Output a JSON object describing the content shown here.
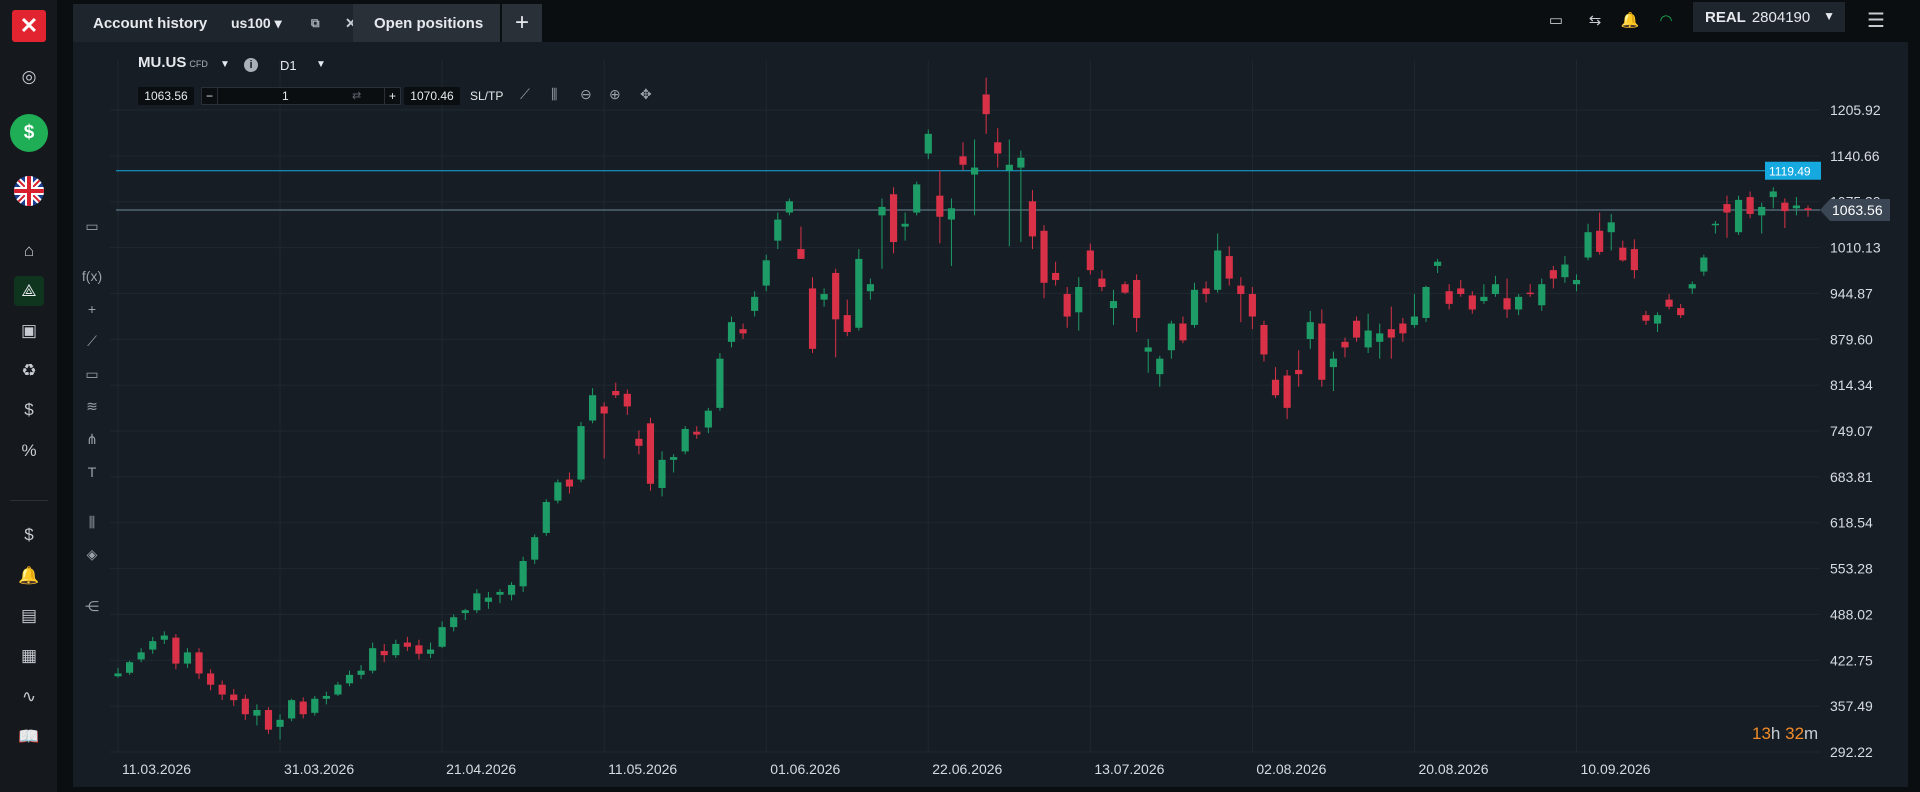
{
  "left_rail": {
    "logo_label": "✕",
    "deposit_label": "$",
    "items": [
      {
        "name": "home-icon",
        "glyph": "⌂"
      },
      {
        "name": "market-watch-icon",
        "glyph": "⟁"
      },
      {
        "name": "news-icon",
        "glyph": "▣"
      },
      {
        "name": "piggy-bank-icon",
        "glyph": "♻"
      },
      {
        "name": "coin-icon",
        "glyph": "$"
      },
      {
        "name": "percent-icon",
        "glyph": "%"
      },
      {
        "name": "transfer-icon",
        "glyph": "$"
      },
      {
        "name": "alerts-icon",
        "glyph": "🔔"
      },
      {
        "name": "reports-icon",
        "glyph": "▤"
      },
      {
        "name": "calendar-icon",
        "glyph": "▦"
      },
      {
        "name": "analytics-icon",
        "glyph": "∿"
      },
      {
        "name": "education-icon",
        "glyph": "📖"
      }
    ]
  },
  "topbar": {
    "tabs": {
      "account_history": "Account history",
      "workspace": "us100",
      "open_positions": "Open positions",
      "add": "+"
    },
    "account": {
      "mode": "REAL",
      "number": "2804190"
    }
  },
  "chart": {
    "symbol": "MU.US",
    "symbol_tag": "CFD",
    "timeframe": "D1",
    "sell_price": "1063.56",
    "buy_price": "1070.46",
    "volume": "1",
    "sltp_label": "SL/TP",
    "timer": {
      "hours": "13",
      "h": "h",
      "minutes": "32",
      "m": "m"
    },
    "colors": {
      "up": "#1e9c67",
      "down": "#d93147",
      "bg": "#161d24",
      "grid": "#1f2831",
      "alert_line": "#16a9e0",
      "price_line": "#6c8a9a"
    }
  },
  "chart_data": {
    "type": "candlestick",
    "symbol": "MU.US",
    "timeframe": "D1",
    "y_ticks": [
      292.22,
      357.49,
      422.75,
      488.02,
      553.28,
      618.54,
      683.81,
      749.07,
      814.34,
      879.6,
      944.87,
      1010.13,
      1075.39,
      1140.66,
      1205.92
    ],
    "y_tick_labels": [
      "292.22",
      "357.49",
      "422.75",
      "488.02",
      "553.28",
      "618.54",
      "683.81",
      "749.07",
      "814.34",
      "879.60",
      "944.87",
      "1010.13",
      "1075.39",
      "1140.66",
      "1205.92"
    ],
    "x_labels": [
      "11.03.2026",
      "31.03.2026",
      "21.04.2026",
      "11.05.2026",
      "01.06.2026",
      "22.06.2026",
      "13.07.2026",
      "02.08.2026",
      "20.08.2026",
      "10.09.2026"
    ],
    "x_label_bar_index": [
      0,
      14,
      28,
      42,
      56,
      70,
      84,
      98,
      112,
      126
    ],
    "ylim": [
      292.22,
      1205.92
    ],
    "current_price": 1063.56,
    "current_price_label": "1063.56",
    "alert_level": 1119.49,
    "alert_level_label": "1119.49",
    "ohlc": [
      [
        400,
        412,
        398,
        404
      ],
      [
        405,
        422,
        402,
        420
      ],
      [
        424,
        440,
        420,
        434
      ],
      [
        438,
        456,
        432,
        450
      ],
      [
        452,
        464,
        446,
        458
      ],
      [
        455,
        460,
        410,
        418
      ],
      [
        418,
        440,
        412,
        434
      ],
      [
        434,
        440,
        396,
        404
      ],
      [
        404,
        410,
        380,
        388
      ],
      [
        388,
        394,
        366,
        374
      ],
      [
        374,
        382,
        358,
        366
      ],
      [
        368,
        374,
        338,
        346
      ],
      [
        344,
        360,
        330,
        352
      ],
      [
        352,
        356,
        318,
        324
      ],
      [
        328,
        346,
        310,
        338
      ],
      [
        340,
        368,
        336,
        366
      ],
      [
        364,
        370,
        340,
        346
      ],
      [
        348,
        372,
        344,
        368
      ],
      [
        368,
        378,
        360,
        372
      ],
      [
        374,
        392,
        372,
        388
      ],
      [
        390,
        408,
        386,
        402
      ],
      [
        402,
        416,
        396,
        408
      ],
      [
        408,
        448,
        404,
        440
      ],
      [
        436,
        446,
        420,
        430
      ],
      [
        430,
        452,
        426,
        446
      ],
      [
        448,
        456,
        436,
        442
      ],
      [
        444,
        452,
        424,
        432
      ],
      [
        432,
        448,
        426,
        438
      ],
      [
        442,
        478,
        440,
        470
      ],
      [
        470,
        488,
        464,
        484
      ],
      [
        490,
        496,
        480,
        494
      ],
      [
        494,
        524,
        490,
        518
      ],
      [
        506,
        520,
        496,
        512
      ],
      [
        516,
        524,
        504,
        520
      ],
      [
        516,
        534,
        508,
        530
      ],
      [
        528,
        570,
        520,
        564
      ],
      [
        566,
        602,
        560,
        598
      ],
      [
        604,
        652,
        600,
        648
      ],
      [
        650,
        680,
        646,
        676
      ],
      [
        680,
        690,
        660,
        670
      ],
      [
        680,
        762,
        676,
        756
      ],
      [
        764,
        810,
        760,
        800
      ],
      [
        784,
        790,
        710,
        774
      ],
      [
        806,
        818,
        796,
        800
      ],
      [
        802,
        808,
        772,
        784
      ],
      [
        738,
        750,
        716,
        728
      ],
      [
        760,
        768,
        664,
        674
      ],
      [
        668,
        720,
        656,
        708
      ],
      [
        708,
        716,
        690,
        712
      ],
      [
        720,
        756,
        716,
        752
      ],
      [
        748,
        756,
        738,
        744
      ],
      [
        754,
        782,
        746,
        778
      ],
      [
        782,
        860,
        778,
        852
      ],
      [
        876,
        912,
        868,
        904
      ],
      [
        894,
        902,
        880,
        888
      ],
      [
        920,
        948,
        912,
        940
      ],
      [
        956,
        1000,
        948,
        992
      ],
      [
        1020,
        1060,
        1008,
        1050
      ],
      [
        1060,
        1080,
        1056,
        1076
      ],
      [
        1008,
        1040,
        996,
        994
      ],
      [
        952,
        968,
        860,
        866
      ],
      [
        936,
        952,
        926,
        944
      ],
      [
        974,
        980,
        854,
        908
      ],
      [
        914,
        936,
        884,
        890
      ],
      [
        896,
        1008,
        892,
        994
      ],
      [
        948,
        966,
        936,
        958
      ],
      [
        1056,
        1080,
        980,
        1068
      ],
      [
        1086,
        1096,
        1002,
        1018
      ],
      [
        1040,
        1060,
        1020,
        1044
      ],
      [
        1060,
        1104,
        1056,
        1100
      ],
      [
        1144,
        1178,
        1136,
        1172
      ],
      [
        1084,
        1120,
        1016,
        1054
      ],
      [
        1050,
        1080,
        984,
        1066
      ],
      [
        1140,
        1160,
        1120,
        1128
      ],
      [
        1114,
        1164,
        1056,
        1124
      ],
      [
        1228,
        1252,
        1172,
        1200
      ],
      [
        1160,
        1180,
        1124,
        1144
      ],
      [
        1120,
        1164,
        1012,
        1128
      ],
      [
        1124,
        1148,
        1018,
        1138
      ],
      [
        1076,
        1092,
        1008,
        1026
      ],
      [
        1034,
        1042,
        938,
        960
      ],
      [
        974,
        990,
        956,
        964
      ],
      [
        944,
        954,
        896,
        912
      ],
      [
        918,
        968,
        892,
        954
      ],
      [
        1006,
        1016,
        972,
        978
      ],
      [
        966,
        978,
        948,
        954
      ],
      [
        924,
        950,
        900,
        934
      ],
      [
        958,
        962,
        944,
        946
      ],
      [
        964,
        972,
        890,
        910
      ],
      [
        862,
        880,
        832,
        868
      ],
      [
        830,
        856,
        812,
        852
      ],
      [
        864,
        906,
        852,
        902
      ],
      [
        902,
        912,
        874,
        878
      ],
      [
        900,
        960,
        896,
        950
      ],
      [
        952,
        962,
        932,
        944
      ],
      [
        950,
        1030,
        946,
        1006
      ],
      [
        998,
        1012,
        956,
        966
      ],
      [
        956,
        968,
        904,
        944
      ],
      [
        944,
        954,
        894,
        912
      ],
      [
        900,
        906,
        848,
        858
      ],
      [
        822,
        840,
        796,
        800
      ],
      [
        828,
        836,
        766,
        782
      ],
      [
        836,
        864,
        812,
        830
      ],
      [
        880,
        920,
        866,
        904
      ],
      [
        902,
        922,
        812,
        822
      ],
      [
        840,
        862,
        806,
        852
      ],
      [
        876,
        882,
        854,
        868
      ],
      [
        906,
        912,
        876,
        882
      ],
      [
        868,
        916,
        860,
        892
      ],
      [
        876,
        902,
        852,
        888
      ],
      [
        894,
        926,
        852,
        882
      ],
      [
        902,
        910,
        876,
        888
      ],
      [
        900,
        944,
        896,
        912
      ],
      [
        910,
        956,
        904,
        954
      ],
      [
        984,
        994,
        974,
        990
      ],
      [
        948,
        958,
        922,
        930
      ],
      [
        952,
        964,
        940,
        944
      ],
      [
        942,
        948,
        916,
        922
      ],
      [
        934,
        958,
        930,
        940
      ],
      [
        944,
        970,
        940,
        958
      ],
      [
        938,
        966,
        910,
        922
      ],
      [
        922,
        944,
        914,
        940
      ],
      [
        946,
        958,
        940,
        944
      ],
      [
        928,
        966,
        920,
        958
      ],
      [
        978,
        984,
        952,
        966
      ],
      [
        968,
        998,
        960,
        986
      ],
      [
        958,
        972,
        948,
        964
      ],
      [
        996,
        1044,
        992,
        1032
      ],
      [
        1034,
        1060,
        1000,
        1004
      ],
      [
        1032,
        1058,
        1006,
        1046
      ],
      [
        1010,
        1020,
        990,
        992
      ],
      [
        1008,
        1022,
        966,
        978
      ],
      [
        914,
        920,
        900,
        906
      ],
      [
        902,
        918,
        890,
        914
      ],
      [
        936,
        944,
        922,
        926
      ],
      [
        924,
        930,
        910,
        914
      ],
      [
        952,
        962,
        944,
        958
      ],
      [
        976,
        1000,
        970,
        996
      ],
      [
        1042,
        1048,
        1030,
        1044
      ],
      [
        1072,
        1084,
        1024,
        1060
      ],
      [
        1032,
        1084,
        1028,
        1078
      ],
      [
        1082,
        1090,
        1052,
        1058
      ],
      [
        1056,
        1074,
        1030,
        1068
      ],
      [
        1082,
        1096,
        1066,
        1090
      ],
      [
        1074,
        1080,
        1038,
        1062
      ],
      [
        1066,
        1082,
        1056,
        1070
      ],
      [
        1066,
        1070,
        1054,
        1063.56
      ]
    ]
  }
}
